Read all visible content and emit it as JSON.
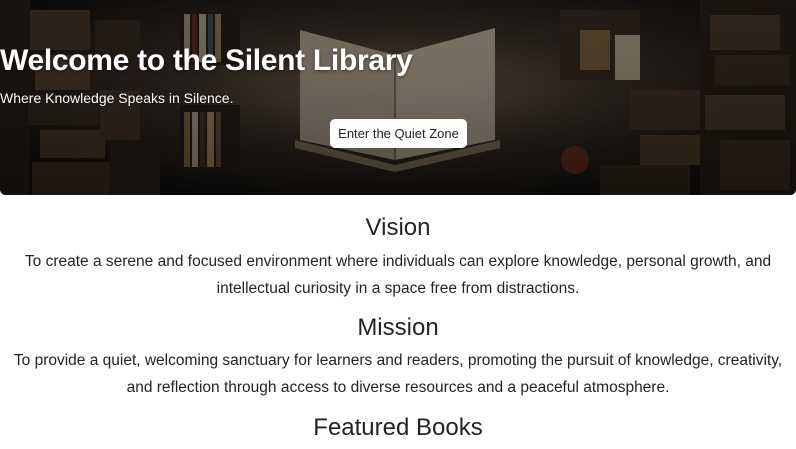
{
  "hero": {
    "title": "Welcome to the Silent Library",
    "subtitle": "Where Knowledge Speaks in Silence.",
    "button_label": "Enter the Quiet Zone"
  },
  "vision": {
    "heading": "Vision",
    "text": "To create a serene and focused environment where individuals can explore knowledge, personal growth, and intellectual curiosity in a space free from distractions."
  },
  "mission": {
    "heading": "Mission",
    "text": "To provide a quiet, welcoming sanctuary for learners and readers, promoting the pursuit of knowledge, creativity, and reflection through access to diverse resources and a peaceful atmosphere."
  },
  "featured": {
    "heading": "Featured Books"
  }
}
